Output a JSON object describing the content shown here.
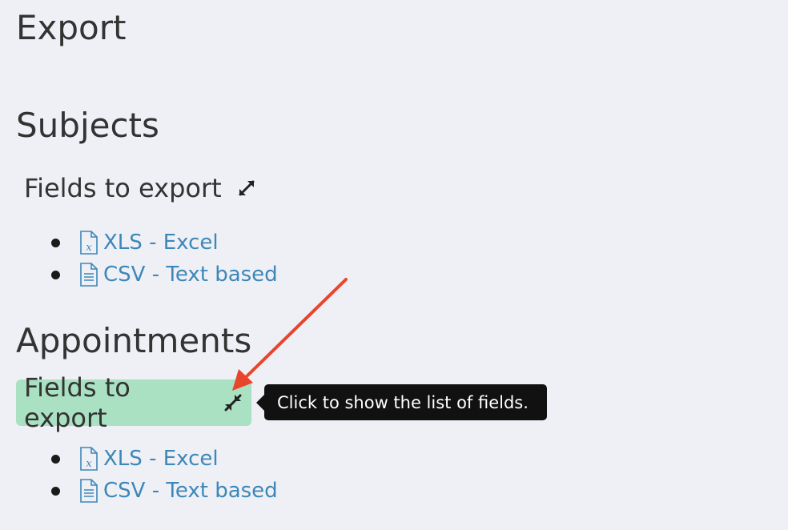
{
  "page": {
    "title": "Export"
  },
  "sections": [
    {
      "title": "Subjects",
      "fields_toggle_label": "Fields to export",
      "toggle_icon": "expand-icon",
      "exports": [
        {
          "label": "XLS - Excel",
          "icon": "excel-file-icon"
        },
        {
          "label": "CSV - Text based",
          "icon": "text-file-icon"
        }
      ]
    },
    {
      "title": "Appointments",
      "fields_toggle_label": "Fields to export",
      "toggle_icon": "collapse-icon",
      "exports": [
        {
          "label": "XLS - Excel",
          "icon": "excel-file-icon"
        },
        {
          "label": "CSV - Text based",
          "icon": "text-file-icon"
        }
      ]
    }
  ],
  "tooltip": {
    "text": "Click to show the list of fields."
  },
  "colors": {
    "background": "#eef0f5",
    "link": "#3d87b8",
    "highlight": "#a9e1c2",
    "tooltip_bg": "#111111",
    "annotation_arrow": "#e8452c"
  }
}
